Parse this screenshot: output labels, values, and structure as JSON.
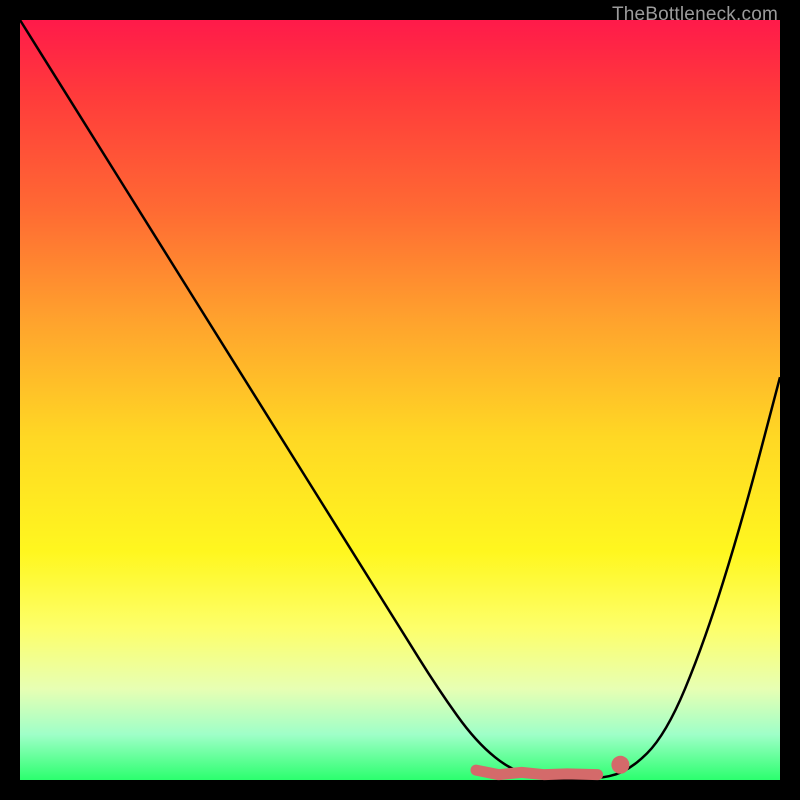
{
  "watermark": "TheBottleneck.com",
  "chart_data": {
    "type": "line",
    "title": "",
    "xlabel": "",
    "ylabel": "",
    "xlim": [
      0,
      100
    ],
    "ylim": [
      0,
      100
    ],
    "grid": false,
    "series": [
      {
        "name": "curve",
        "x": [
          0,
          5,
          10,
          15,
          20,
          25,
          30,
          35,
          40,
          45,
          50,
          55,
          60,
          65,
          70,
          75,
          80,
          85,
          90,
          95,
          100
        ],
        "y": [
          100,
          92,
          84,
          76,
          68,
          60,
          52,
          44,
          36,
          28,
          20,
          12,
          5,
          1,
          0,
          0,
          1,
          6,
          18,
          34,
          53
        ]
      }
    ],
    "annotations": {
      "squiggle": {
        "x": [
          60,
          63,
          66,
          69,
          72,
          76
        ],
        "y": [
          1.3,
          0.7,
          1.0,
          0.7,
          0.8,
          0.7
        ]
      },
      "dot": {
        "x": 79,
        "y": 2
      }
    },
    "background_gradient": [
      "#ff1a4a",
      "#ffd824",
      "#2bff6e"
    ]
  }
}
